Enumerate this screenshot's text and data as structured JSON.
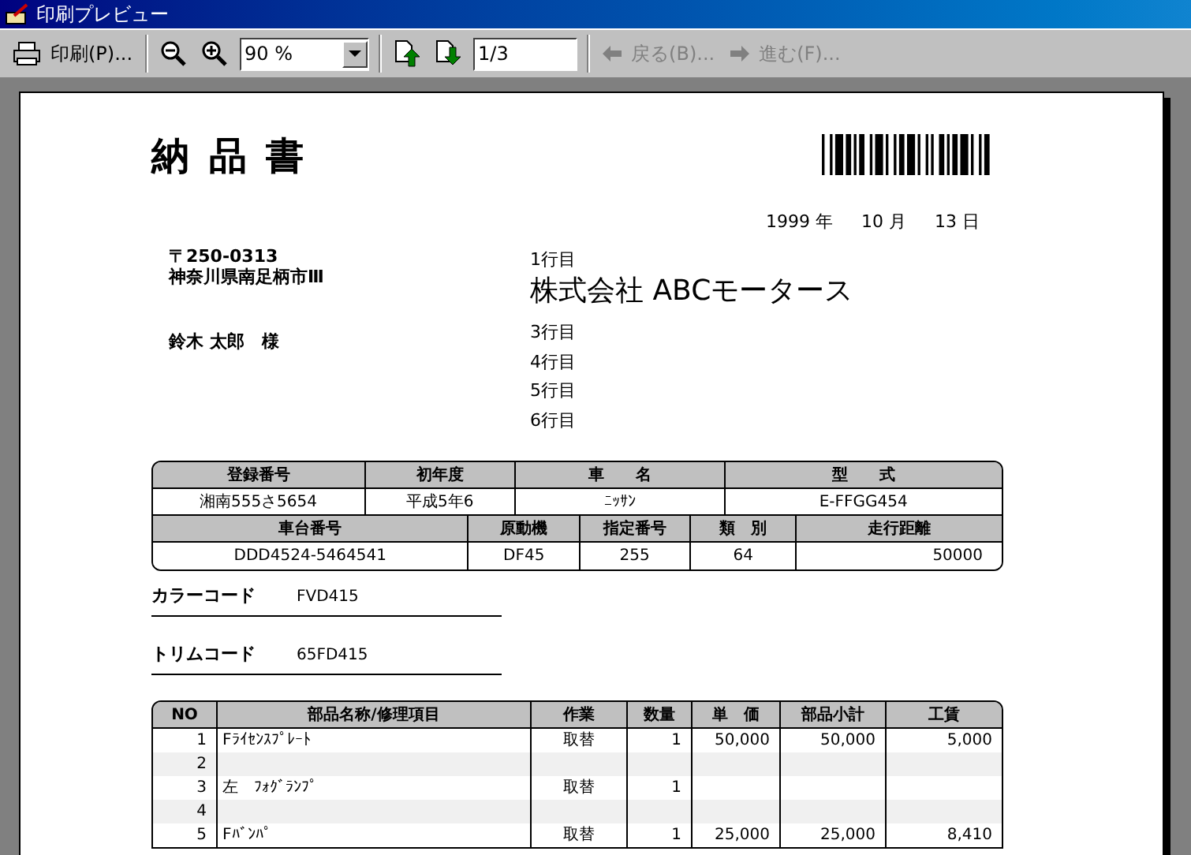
{
  "window": {
    "title": "印刷プレビュー"
  },
  "toolbar": {
    "print": "印刷(P)...",
    "zoom": "90 %",
    "page": "1/3",
    "nav": [
      {
        "label": "戻る(B)...",
        "disabled": true
      },
      {
        "label": "進む(F)...",
        "disabled": true
      }
    ]
  },
  "document": {
    "title": "納 品 書",
    "date": [
      "1999 年",
      "10 月",
      "13 日"
    ],
    "postal": "〒250-0313",
    "address": "神奈川県南足柄市Ⅲ",
    "customer": "鈴木 太郎　様",
    "lines": [
      {
        "kind": "small",
        "text": "1行目"
      },
      {
        "kind": "large",
        "text": "株式会社 ABCモータース"
      },
      {
        "kind": "small",
        "text": "3行目"
      },
      {
        "kind": "small",
        "text": "4行目"
      },
      {
        "kind": "small",
        "text": "5行目"
      },
      {
        "kind": "small",
        "text": "6行目"
      }
    ],
    "vehicle": {
      "headers1": [
        "登録番号",
        "初年度",
        "車　　名",
        "型　　式"
      ],
      "values1": [
        "湘南555さ5654",
        "平成5年6",
        "ﾆｯｻﾝ",
        "E-FFGG454"
      ],
      "headers2": [
        "車台番号",
        "原動機",
        "指定番号",
        "類　別",
        "走行距離"
      ],
      "values2": [
        "DDD4524-5464541",
        "DF45",
        "255",
        "64",
        "50000"
      ]
    },
    "codes": [
      {
        "label": "カラーコード",
        "value": "FVD415"
      },
      {
        "label": "トリムコード",
        "value": "65FD415"
      }
    ],
    "parts": {
      "columns": [
        "NO",
        "部品名称/修理項目",
        "作業",
        "数量",
        "単　価",
        "部品小計",
        "工賃"
      ],
      "rows": [
        [
          "1",
          "Fﾗｲｾﾝｽﾌﾟﾚｰﾄ",
          "取替",
          "1",
          "50,000",
          "50,000",
          "5,000"
        ],
        [
          "2",
          "",
          "",
          "",
          "",
          "",
          ""
        ],
        [
          "3",
          "左　ﾌｫｸﾞﾗﾝﾌﾟ",
          "取替",
          "1",
          "",
          "",
          ""
        ],
        [
          "4",
          "",
          "",
          "",
          "",
          "",
          ""
        ],
        [
          "5",
          "Fﾊﾞﾝﾊﾟ",
          "取替",
          "1",
          "25,000",
          "25,000",
          "8,410"
        ]
      ]
    }
  }
}
